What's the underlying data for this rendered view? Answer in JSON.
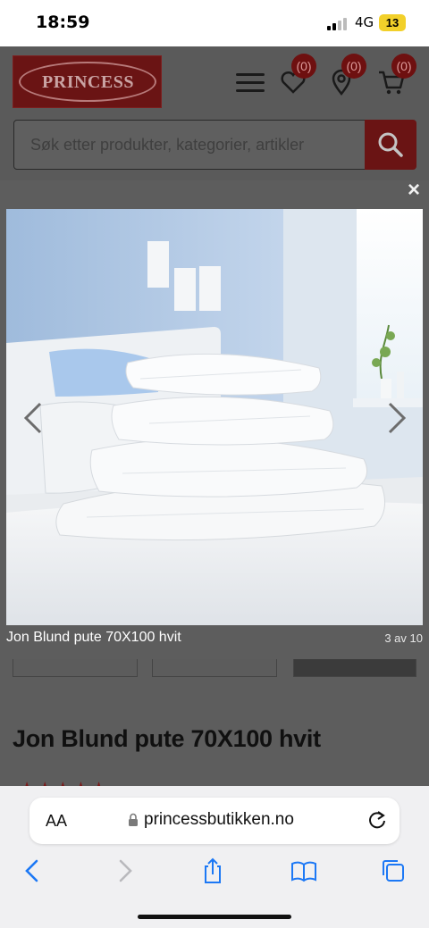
{
  "status_bar": {
    "time": "18:59",
    "network": "4G",
    "battery": "13"
  },
  "header": {
    "logo_text": "PRINCESS",
    "wishlist_count": "(0)",
    "stores_count": "(0)",
    "cart_count": "(0)",
    "search_placeholder": "Søk etter produkter, kategorier, artikler"
  },
  "product": {
    "title": "Jon Blund pute 70X100 hvit",
    "stars": "★★★★★"
  },
  "lightbox": {
    "caption": "Jon Blund pute 70X100 hvit",
    "counter": "3 av 10",
    "close_label": "×"
  },
  "browser": {
    "aa": "AA",
    "url": "princessbutikken.no"
  },
  "colors": {
    "brand": "#c0272d",
    "battery": "#f2d02a",
    "wall": "#bcd0e8"
  }
}
